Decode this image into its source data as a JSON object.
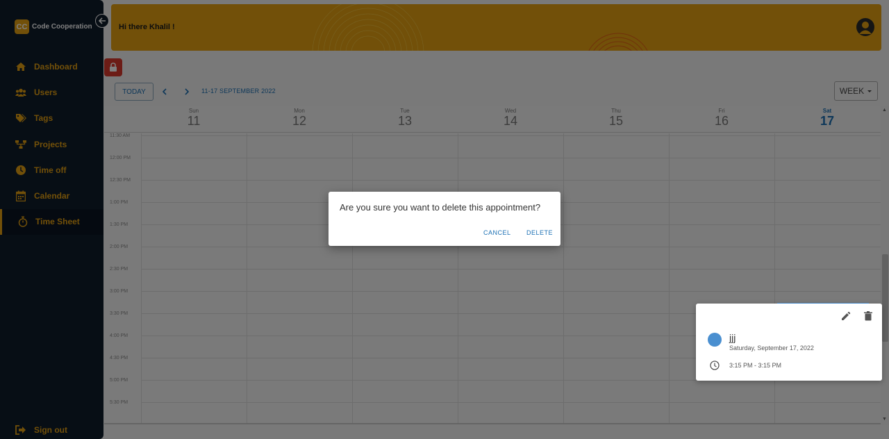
{
  "sidebar": {
    "brand_logo": "CC",
    "brand_name": "Code Cooperation",
    "items": [
      {
        "label": "Dashboard",
        "icon": "home-icon"
      },
      {
        "label": "Users",
        "icon": "users-icon"
      },
      {
        "label": "Tags",
        "icon": "tags-icon"
      },
      {
        "label": "Projects",
        "icon": "sitemap-icon"
      },
      {
        "label": "Time off",
        "icon": "clock-icon"
      },
      {
        "label": "Calendar",
        "icon": "calendar-icon"
      },
      {
        "label": "Time Sheet",
        "icon": "stopwatch-icon",
        "active": true
      }
    ],
    "signout_label": "Sign out"
  },
  "header": {
    "greeting": "Hi there Khalil !"
  },
  "toolbar": {
    "today_label": "TODAY",
    "date_range": "11-17 SEPTEMBER 2022",
    "view_label": "WEEK"
  },
  "calendar": {
    "days": [
      {
        "name": "Sun",
        "num": "11"
      },
      {
        "name": "Mon",
        "num": "12"
      },
      {
        "name": "Tue",
        "num": "13"
      },
      {
        "name": "Wed",
        "num": "14"
      },
      {
        "name": "Thu",
        "num": "15"
      },
      {
        "name": "Fri",
        "num": "16"
      },
      {
        "name": "Sat",
        "num": "17",
        "today": true
      }
    ],
    "times": [
      "11:30 AM",
      "12:00 PM",
      "12:30 PM",
      "1:00 PM",
      "1:30 PM",
      "2:00 PM",
      "2:30 PM",
      "3:00 PM",
      "3:30 PM",
      "4:00 PM",
      "4:30 PM",
      "5:00 PM",
      "5:30 PM"
    ]
  },
  "appointment": {
    "title": "jjj",
    "date": "Saturday, September 17, 2022",
    "time": "3:15 PM - 3:15 PM"
  },
  "dialog": {
    "message": "Are you sure you want to delete this appointment?",
    "cancel_label": "CANCEL",
    "delete_label": "DELETE"
  },
  "colors": {
    "accent": "#e4a012",
    "sidebar": "#0f1c2b",
    "primary": "#1a6fb3",
    "lock": "#d8382d"
  }
}
